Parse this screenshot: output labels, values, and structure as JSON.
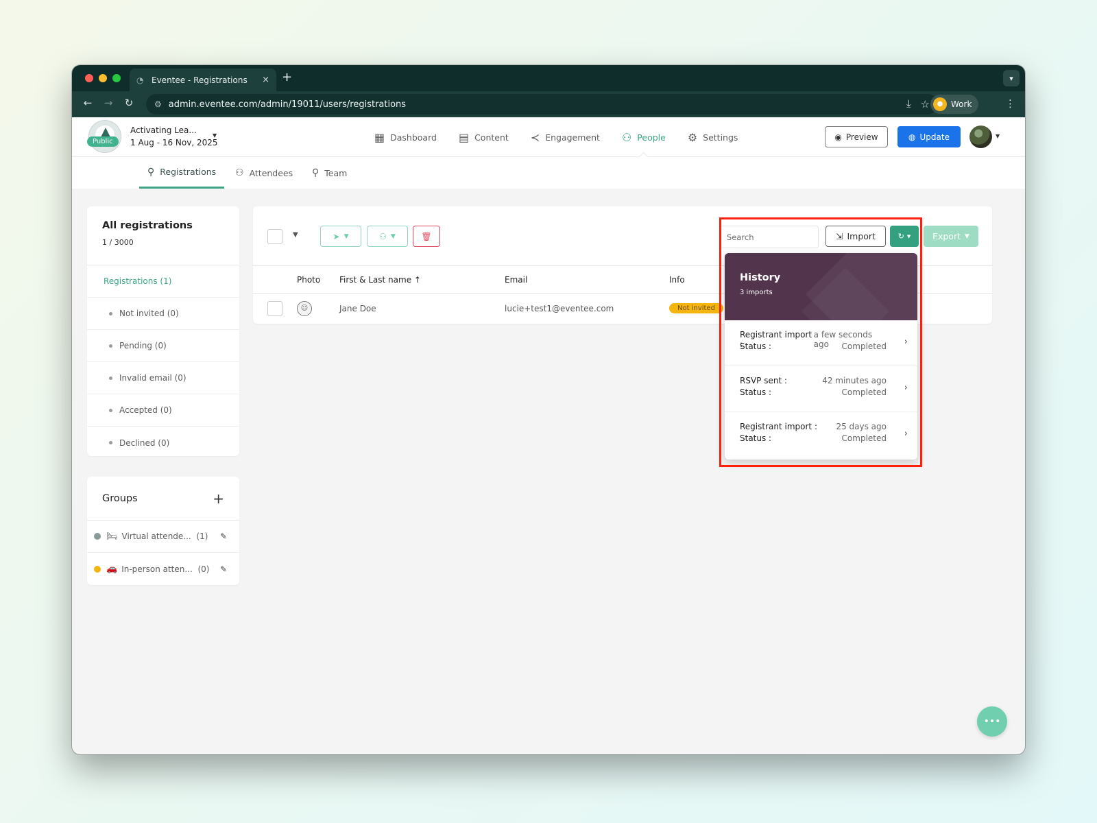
{
  "browser": {
    "tab_title": "Eventee - Registrations",
    "tab_close": "×",
    "new_tab": "+",
    "url": "admin.eventee.com/admin/19011/users/registrations",
    "profile_name": "Work",
    "colors": {
      "close": "#ff5f57",
      "minimize": "#febc2e",
      "maximize": "#28c840"
    }
  },
  "event": {
    "name": "Activating Lea...",
    "dates": "1 Aug - 16 Nov, 2025",
    "visibility_badge": "Public"
  },
  "main_nav": [
    {
      "label": "Dashboard",
      "icon": "dashboard-icon",
      "active": false
    },
    {
      "label": "Content",
      "icon": "calendar-icon",
      "active": false
    },
    {
      "label": "Engagement",
      "icon": "share-icon",
      "active": false
    },
    {
      "label": "People",
      "icon": "people-icon",
      "active": true
    },
    {
      "label": "Settings",
      "icon": "gear-icon",
      "active": false
    }
  ],
  "header_actions": {
    "preview_label": "Preview",
    "update_label": "Update"
  },
  "sub_nav": [
    {
      "label": "Registrations",
      "icon": "user-check-icon",
      "active": true
    },
    {
      "label": "Attendees",
      "icon": "users-icon",
      "active": false
    },
    {
      "label": "Team",
      "icon": "team-icon",
      "active": false
    }
  ],
  "filters": {
    "title": "All registrations",
    "count": "1 / 3000",
    "main_item": "Registrations (1)",
    "items": [
      "Not invited (0)",
      "Pending (0)",
      "Invalid email (0)",
      "Accepted (0)",
      "Declined (0)"
    ]
  },
  "groups": {
    "title": "Groups",
    "add": "+",
    "items": [
      {
        "name": "Virtual attende...",
        "count": "(1)",
        "emoji": "🛏",
        "color": "#8a9a98"
      },
      {
        "name": "In-person atten...",
        "count": "(0)",
        "emoji": "🚗",
        "color": "#f4b511"
      }
    ]
  },
  "toolbar": {
    "search_placeholder": "Search",
    "import_label": "Import",
    "export_label": "Export"
  },
  "table": {
    "columns": [
      "Photo",
      "First & Last name ↑",
      "Email",
      "Info"
    ],
    "rows": [
      {
        "name": "Jane Doe",
        "email": "lucie+test1@eventee.com",
        "status": "Not invited"
      }
    ]
  },
  "history": {
    "title": "History",
    "count_label": "3 imports",
    "items": [
      {
        "label": "Registrant import :",
        "time": "a few seconds ago",
        "status_label": "Status :",
        "status": "Completed"
      },
      {
        "label": "RSVP sent :",
        "time": "42 minutes ago",
        "status_label": "Status :",
        "status": "Completed"
      },
      {
        "label": "Registrant import :",
        "time": "25 days ago",
        "status_label": "Status :",
        "status": "Completed"
      }
    ]
  },
  "colors": {
    "accent": "#3aa584",
    "primary_blue": "#1a73e8",
    "history_header": "#52354d",
    "highlight_border": "#ff1f0a",
    "status_badge": "#f4b511"
  }
}
